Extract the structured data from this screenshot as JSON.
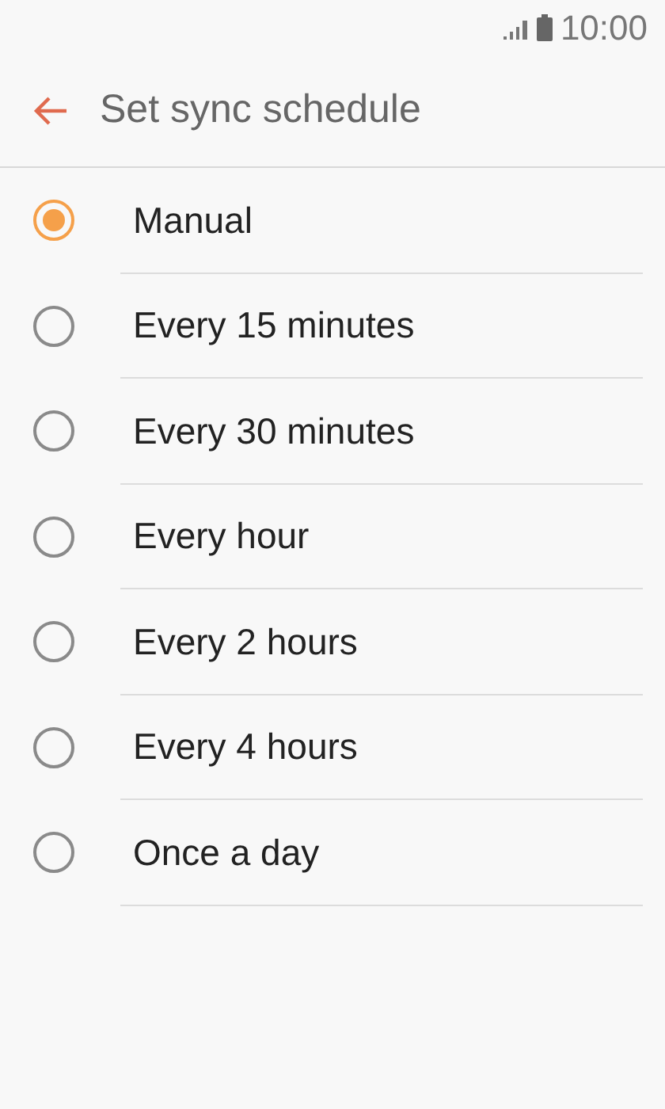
{
  "status_bar": {
    "time": "10:00"
  },
  "header": {
    "title": "Set sync schedule"
  },
  "options": [
    {
      "label": "Manual",
      "selected": true
    },
    {
      "label": "Every 15 minutes",
      "selected": false
    },
    {
      "label": "Every 30 minutes",
      "selected": false
    },
    {
      "label": "Every hour",
      "selected": false
    },
    {
      "label": "Every 2 hours",
      "selected": false
    },
    {
      "label": "Every 4 hours",
      "selected": false
    },
    {
      "label": "Once a day",
      "selected": false
    }
  ]
}
